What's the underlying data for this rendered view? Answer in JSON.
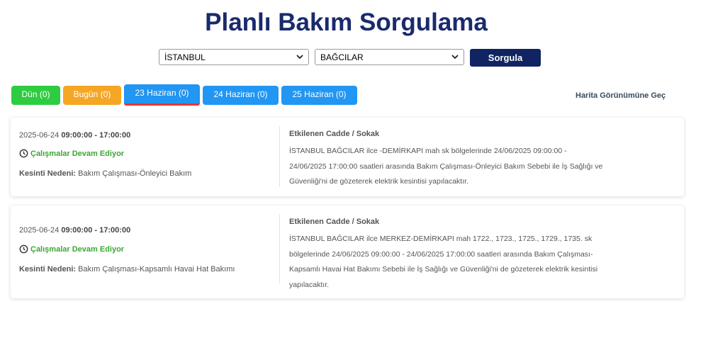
{
  "page": {
    "title": "Planlı Bakım Sorgulama"
  },
  "filters": {
    "city": "İSTANBUL",
    "district": "BAĞCILAR",
    "query_label": "Sorgula"
  },
  "tabs": [
    {
      "label": "Dün (0)",
      "color": "#2ecc40"
    },
    {
      "label": "Bugün (0)",
      "color": "#f5a623"
    },
    {
      "label": "23 Haziran (0)",
      "color": "#2196f3",
      "active": true
    },
    {
      "label": "24 Haziran (0)",
      "color": "#2196f3"
    },
    {
      "label": "25 Haziran (0)",
      "color": "#2196f3"
    }
  ],
  "map_link": "Harita Görünümüne Geç",
  "cards": [
    {
      "date": "2025-06-24",
      "time": "09:00:00 - 17:00:00",
      "status": "Çalışmalar Devam Ediyor",
      "reason_label": "Kesinti Nedeni:",
      "reason": "Bakım Çalışması-Önleyici Bakım",
      "streets_title": "Etkilenen Cadde / Sokak",
      "lines": [
        "İSTANBUL BAĞCILAR ilce -DEMİRKAPI mah sk bölgelerinde 24/06/2025 09:00:00 -",
        "24/06/2025 17:00:00 saatleri arasında Bakım Çalışması-Önleyici Bakım Sebebi ile İş Sağlığı ve",
        "Güvenliği'ni de gözeterek elektrik kesintisi yapılacaktır."
      ]
    },
    {
      "date": "2025-06-24",
      "time": "09:00:00 - 17:00:00",
      "status": "Çalışmalar Devam Ediyor",
      "reason_label": "Kesinti Nedeni:",
      "reason": "Bakım Çalışması-Kapsamlı Havai Hat Bakımı",
      "streets_title": "Etkilenen Cadde / Sokak",
      "lines": [
        "İSTANBUL BAĞCILAR ilce MERKEZ-DEMİRKAPI mah 1722., 1723., 1725., 1729., 1735. sk",
        "bölgelerinde 24/06/2025 09:00:00 - 24/06/2025 17:00:00 saatleri arasında Bakım Çalışması-",
        "Kapsamlı Havai Hat Bakımı Sebebi ile İş Sağlığı ve Güvenliği'ni de gözeterek elektrik kesintisi",
        "yapılacaktır."
      ]
    }
  ]
}
